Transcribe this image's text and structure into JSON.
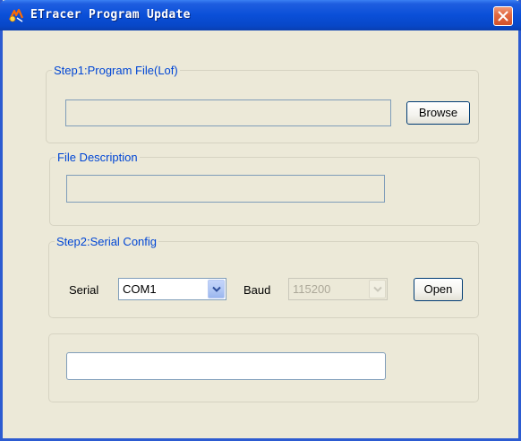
{
  "window": {
    "title": "ETracer Program Update"
  },
  "step1": {
    "legend": "Step1:Program File(Lof)",
    "file_path_value": "",
    "browse_label": "Browse"
  },
  "file_description": {
    "legend": "File Description",
    "value": ""
  },
  "step2": {
    "legend": "Step2:Serial Config",
    "serial_label": "Serial",
    "serial_value": "COM1",
    "baud_label": "Baud",
    "baud_value": "115200",
    "open_label": "Open"
  },
  "progress": {
    "value": ""
  },
  "colors": {
    "titlebar": "#0a4fd8",
    "legend_text": "#0046d5",
    "window_bg": "#ece9d8",
    "close_button": "#e36b43"
  },
  "icons": {
    "app": "etracer-app-icon",
    "close": "close-icon",
    "dropdown": "chevron-down-icon"
  }
}
